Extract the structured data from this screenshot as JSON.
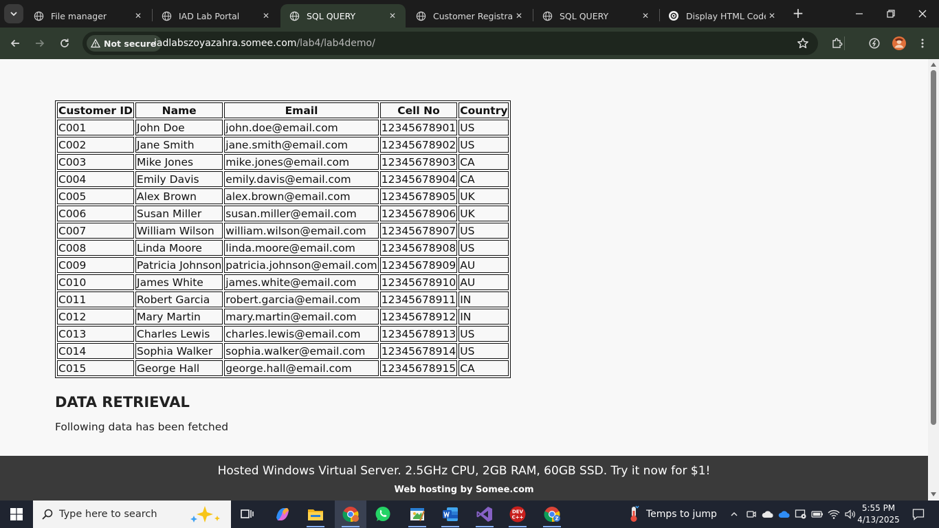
{
  "browser": {
    "tabs": [
      {
        "title": "File manager",
        "active": false,
        "icon": "globe-icon"
      },
      {
        "title": "IAD Lab Portal",
        "active": false,
        "icon": "globe-icon"
      },
      {
        "title": "SQL QUERY",
        "active": true,
        "icon": "globe-icon"
      },
      {
        "title": "Customer Registration",
        "active": false,
        "icon": "globe-icon"
      },
      {
        "title": "SQL QUERY",
        "active": false,
        "icon": "globe-icon"
      },
      {
        "title": "Display HTML Code",
        "active": false,
        "icon": "openai-icon"
      }
    ],
    "tab_close_glyph": "✕",
    "new_tab_glyph": "+",
    "security_label": "Not secure",
    "url_host": "iadlabszoyazahra.somee.com",
    "url_path": "/lab4/lab4demo/"
  },
  "table": {
    "headers": [
      "Customer ID",
      "Name",
      "Email",
      "Cell No",
      "Country"
    ],
    "rows": [
      [
        "C001",
        "John Doe",
        "john.doe@email.com",
        "12345678901",
        "US"
      ],
      [
        "C002",
        "Jane Smith",
        "jane.smith@email.com",
        "12345678902",
        "US"
      ],
      [
        "C003",
        "Mike Jones",
        "mike.jones@email.com",
        "12345678903",
        "CA"
      ],
      [
        "C004",
        "Emily Davis",
        "emily.davis@email.com",
        "12345678904",
        "CA"
      ],
      [
        "C005",
        "Alex Brown",
        "alex.brown@email.com",
        "12345678905",
        "UK"
      ],
      [
        "C006",
        "Susan Miller",
        "susan.miller@email.com",
        "12345678906",
        "UK"
      ],
      [
        "C007",
        "William Wilson",
        "william.wilson@email.com",
        "12345678907",
        "US"
      ],
      [
        "C008",
        "Linda Moore",
        "linda.moore@email.com",
        "12345678908",
        "US"
      ],
      [
        "C009",
        "Patricia Johnson",
        "patricia.johnson@email.com",
        "12345678909",
        "AU"
      ],
      [
        "C010",
        "James White",
        "james.white@email.com",
        "12345678910",
        "AU"
      ],
      [
        "C011",
        "Robert Garcia",
        "robert.garcia@email.com",
        "12345678911",
        "IN"
      ],
      [
        "C012",
        "Mary Martin",
        "mary.martin@email.com",
        "12345678912",
        "IN"
      ],
      [
        "C013",
        "Charles Lewis",
        "charles.lewis@email.com",
        "12345678913",
        "US"
      ],
      [
        "C014",
        "Sophia Walker",
        "sophia.walker@email.com",
        "12345678914",
        "US"
      ],
      [
        "C015",
        "George Hall",
        "george.hall@email.com",
        "12345678915",
        "CA"
      ]
    ]
  },
  "page": {
    "heading": "DATA RETRIEVAL",
    "subtext": "Following data has been fetched"
  },
  "banner": {
    "main": "Hosted Windows Virtual Server. 2.5GHz CPU, 2GB RAM, 60GB SSD. Try it now for $1!",
    "sub": "Web hosting by Somee.com"
  },
  "taskbar": {
    "search_placeholder": "Type here to search",
    "weather_label": "Temps to jump",
    "time": "5:55 PM",
    "date": "4/13/2025",
    "dev_icon_text": "DEV\nC++"
  },
  "colors": {
    "tab_strip": "#1c1c1c",
    "toolbar": "#2f3b2f",
    "page_bg": "#f8f8f8",
    "banner_bg": "#3a3a3a",
    "taskbar_bg": "#1f2430"
  }
}
